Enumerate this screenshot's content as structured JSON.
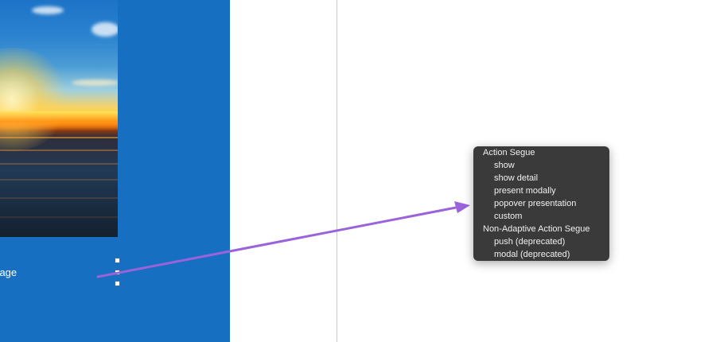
{
  "scene": {
    "image_label": "Image",
    "background_color": "#176fc1"
  },
  "segue_menu": {
    "sections": [
      {
        "header": "Action Segue",
        "items": [
          "show",
          "show detail",
          "present modally",
          "popover presentation",
          "custom"
        ]
      },
      {
        "header": "Non-Adaptive Action Segue",
        "items": [
          "push (deprecated)",
          "modal (deprecated)"
        ]
      }
    ]
  },
  "colors": {
    "connection_arrow": "#9a63dc",
    "menu_background": "#3a3a3a"
  }
}
